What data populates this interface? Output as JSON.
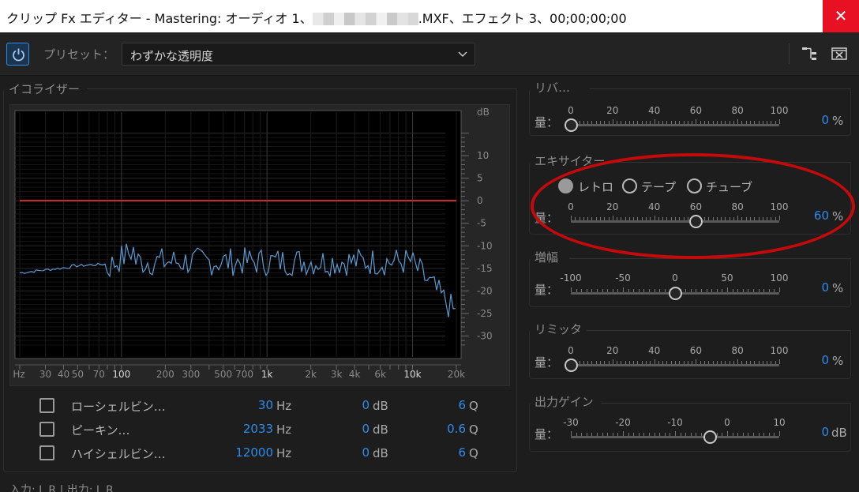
{
  "window": {
    "title_prefix": "クリップ Fx エディター - Mastering: オーディオ 1、",
    "title_suffix": ".MXF、エフェクト 3、00;00;00;00",
    "close_glyph": "✕"
  },
  "toolbar": {
    "preset_label": "プリセット：",
    "preset_value": "わずかな透明度",
    "power_icon": "power-icon",
    "routing_icon": "routing-icon",
    "bypass_icon": "bypass-icon"
  },
  "equalizer": {
    "legend": "イコライザー",
    "db_label": "dB",
    "db_ticks": [
      "10",
      "5",
      "0",
      "-5",
      "-10",
      "-15",
      "-20",
      "-25",
      "-30"
    ],
    "freq_ticks": [
      "Hz",
      "30",
      "40",
      "50",
      "70",
      "100",
      "200",
      "300",
      "500",
      "700",
      "1k",
      "2k",
      "3k",
      "4k",
      "6k",
      "10k",
      "20k"
    ],
    "curve_color": "#d23030",
    "spectrum_color": "#5b9bd5",
    "bands": [
      {
        "name": "ローシェルビン…",
        "freq": "30",
        "freq_unit": "Hz",
        "gain": "0",
        "gain_unit": "dB",
        "q": "6",
        "q_unit": "Q"
      },
      {
        "name": "ピーキン…",
        "freq": "2033",
        "freq_unit": "Hz",
        "gain": "0",
        "gain_unit": "dB",
        "q": "0.6",
        "q_unit": "Q"
      },
      {
        "name": "ハイシェルビン…",
        "freq": "12000",
        "freq_unit": "Hz",
        "gain": "0",
        "gain_unit": "dB",
        "q": "6",
        "q_unit": "Q"
      }
    ]
  },
  "io": "入力: L R | 出力: L R",
  "amount_label": "量：",
  "reverb": {
    "legend": "リバ…",
    "scale": [
      "0",
      "20",
      "40",
      "60",
      "80",
      "100"
    ],
    "value": "0",
    "unit": "%",
    "level": 0
  },
  "exciter": {
    "legend": "エキサイター",
    "modes": [
      "レトロ",
      "テープ",
      "チューブ"
    ],
    "selected": "レトロ",
    "scale": [
      "0",
      "20",
      "40",
      "60",
      "80",
      "100"
    ],
    "value": "60",
    "unit": "%",
    "level": 0.6
  },
  "widener": {
    "legend": "増幅",
    "scale": [
      "-100",
      "-50",
      "0",
      "50",
      "100"
    ],
    "value": "0",
    "unit": "%",
    "level": 0.5
  },
  "limiter": {
    "legend": "リミッタ",
    "scale": [
      "0",
      "20",
      "40",
      "60",
      "80",
      "100"
    ],
    "value": "0",
    "unit": "%",
    "level": 0
  },
  "output_gain": {
    "legend": "出力ゲイン",
    "scale": [
      "-30",
      "-20",
      "-10",
      "0",
      "10"
    ],
    "value": "0",
    "unit": "dB",
    "level": 0.667
  },
  "accent_color": "#2d8ceb",
  "annotation_color": "#c40a0a"
}
